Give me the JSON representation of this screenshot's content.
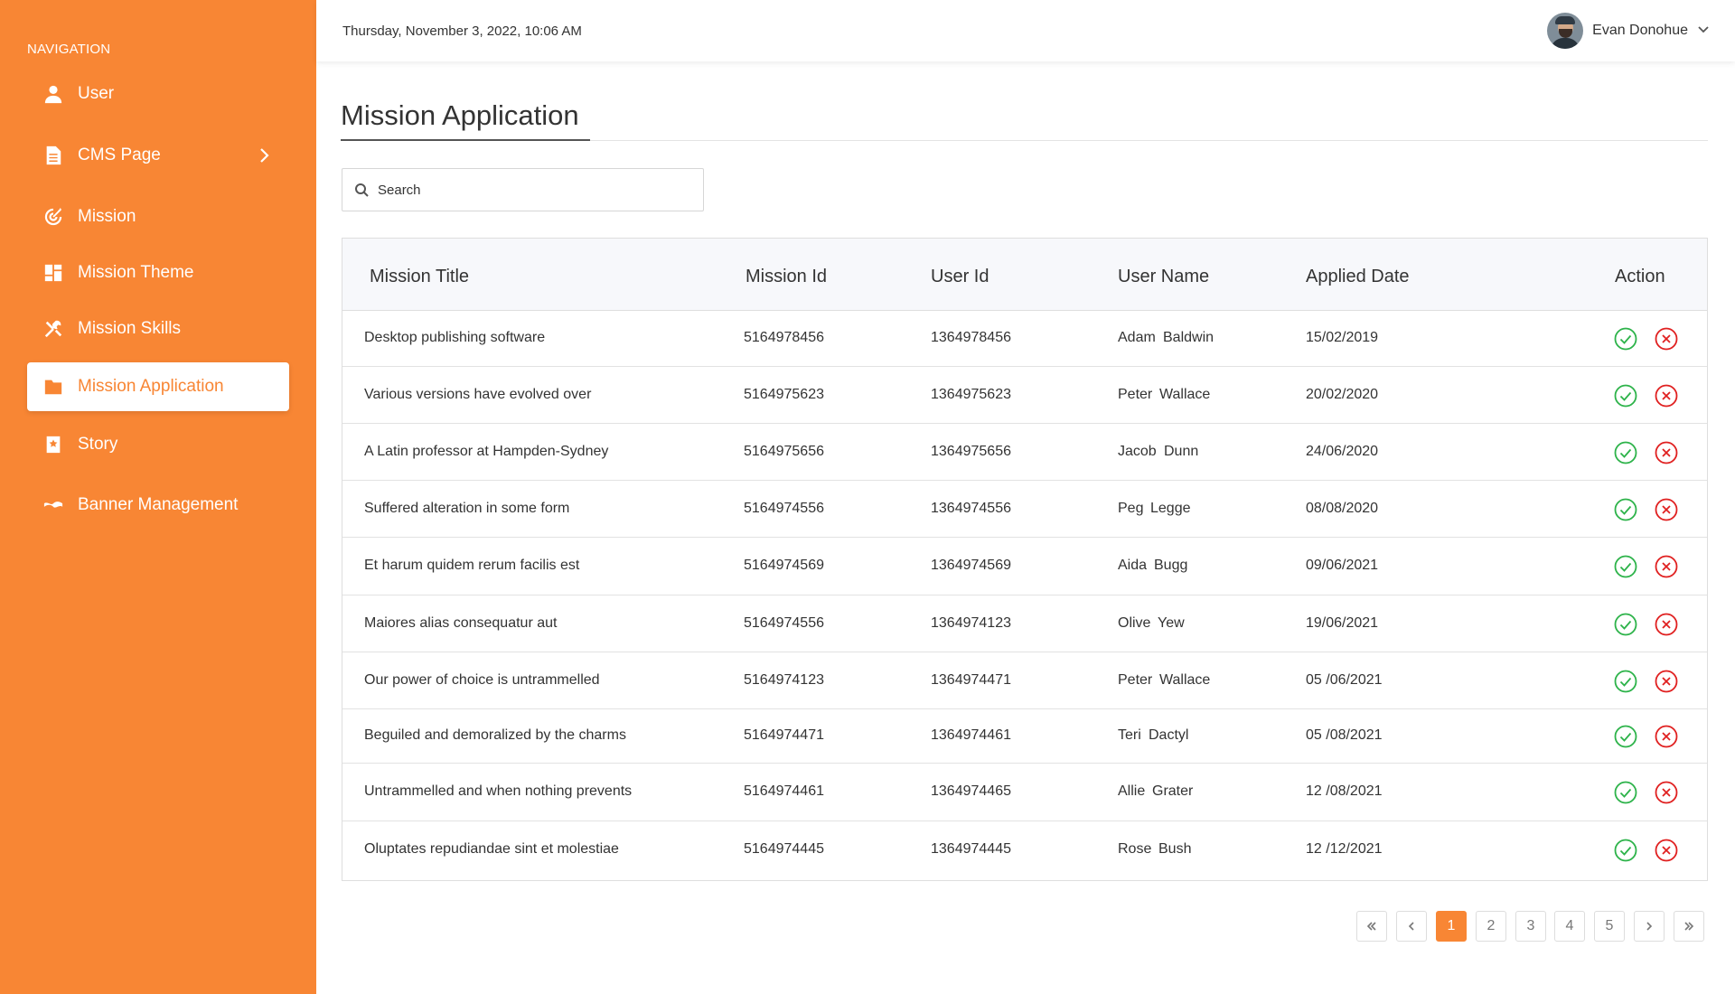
{
  "sidebar": {
    "heading": "NAVIGATION",
    "items": [
      {
        "label": "User",
        "icon": "user-icon"
      },
      {
        "label": "CMS Page",
        "icon": "document-icon"
      },
      {
        "label": "Mission",
        "icon": "target-icon"
      },
      {
        "label": "Mission Theme",
        "icon": "dashboard-icon"
      },
      {
        "label": "Mission Skills",
        "icon": "tools-icon"
      },
      {
        "label": "Mission Application",
        "icon": "folder-icon",
        "active": true
      },
      {
        "label": "Story",
        "icon": "story-icon"
      },
      {
        "label": "Banner Management",
        "icon": "banner-icon"
      }
    ]
  },
  "header": {
    "datetime": "Thursday, November 3, 2022, 10:06 AM",
    "user_name": "Evan Donohue"
  },
  "main": {
    "title": "Mission Application",
    "search_placeholder": "Search",
    "columns": [
      "Mission Title",
      "Mission Id",
      "User Id",
      "User Name",
      "Applied Date",
      "Action"
    ],
    "rows": [
      {
        "title": "Desktop publishing software",
        "mission_id": "5164978456",
        "user_id": "1364978456",
        "first": "Adam",
        "last": "Baldwin",
        "date": "15/02/2019"
      },
      {
        "title": "Various versions have evolved over",
        "mission_id": "5164975623",
        "user_id": "1364975623",
        "first": "Peter",
        "last": "Wallace",
        "date": "20/02/2020"
      },
      {
        "title": "A Latin professor at Hampden-Sydney",
        "mission_id": "5164975656",
        "user_id": "1364975656",
        "first": "Jacob",
        "last": "Dunn",
        "date": "24/06/2020"
      },
      {
        "title": "Suffered alteration in some form",
        "mission_id": "5164974556",
        "user_id": "1364974556",
        "first": "Peg",
        "last": "Legge",
        "date": "08/08/2020"
      },
      {
        "title": "Et harum quidem rerum facilis est",
        "mission_id": "5164974569",
        "user_id": "1364974569",
        "first": "Aida",
        "last": "Bugg",
        "date": "09/06/2021"
      },
      {
        "title": "Maiores alias consequatur aut",
        "mission_id": "5164974556",
        "user_id": "1364974123",
        "first": "Olive",
        "last": "Yew",
        "date": "19/06/2021"
      },
      {
        "title": "Our power of choice is untrammelled",
        "mission_id": "5164974123",
        "user_id": "1364974471",
        "first": "Peter",
        "last": "Wallace",
        "date": "05 /06/2021"
      },
      {
        "title": "Beguiled and demoralized by the charms",
        "mission_id": "5164974471",
        "user_id": "1364974461",
        "first": "Teri",
        "last": "Dactyl",
        "date": "05 /08/2021"
      },
      {
        "title": "Untrammelled and when nothing prevents",
        "mission_id": "5164974461",
        "user_id": "1364974465",
        "first": "Allie",
        "last": "Grater",
        "date": "12 /08/2021"
      },
      {
        "title": "Oluptates repudiandae sint et molestiae",
        "mission_id": "5164974445",
        "user_id": "1364974445",
        "first": "Rose",
        "last": "Bush",
        "date": "12 /12/2021"
      }
    ]
  },
  "pagination": {
    "pages": [
      "1",
      "2",
      "3",
      "4",
      "5"
    ],
    "current": "1"
  },
  "colors": {
    "brand": "#f88634",
    "approve": "#2db34a",
    "decline": "#e02020"
  }
}
